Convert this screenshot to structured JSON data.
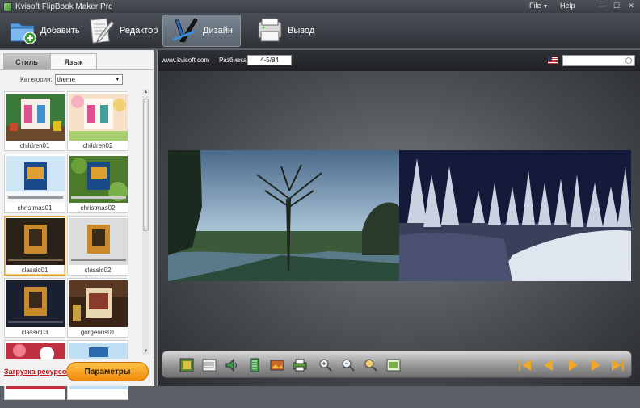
{
  "app": {
    "title": "Kvisoft FlipBook Maker Pro",
    "menu": {
      "file_label": "File",
      "help_label": "Help"
    }
  },
  "toolbar": {
    "add_label": "Добавить",
    "editor_label": "Редактор",
    "design_label": "Дизайн",
    "output_label": "Вывод"
  },
  "left_panel": {
    "tabs": [
      "Стиль",
      "Язык"
    ],
    "category_label": "Категории:",
    "category_value": "theme",
    "thumbnails": [
      "children01",
      "children02",
      "christmas01",
      "christmas02",
      "classic01",
      "classic02",
      "classic03",
      "gorgeous01",
      "",
      ""
    ],
    "selected_thumbnail": "classic01",
    "resources_link": "Загрузка ресурсов",
    "params_button": "Параметры"
  },
  "preview": {
    "site_link": "www.kvisoft.com",
    "page_label": "Разбивка:",
    "page_value": "4-5/84",
    "search_placeholder": ""
  },
  "colors": {
    "accent_orange": "#f08a0a",
    "link_red": "#c01818",
    "toolbar_dark": "#2f3338"
  }
}
